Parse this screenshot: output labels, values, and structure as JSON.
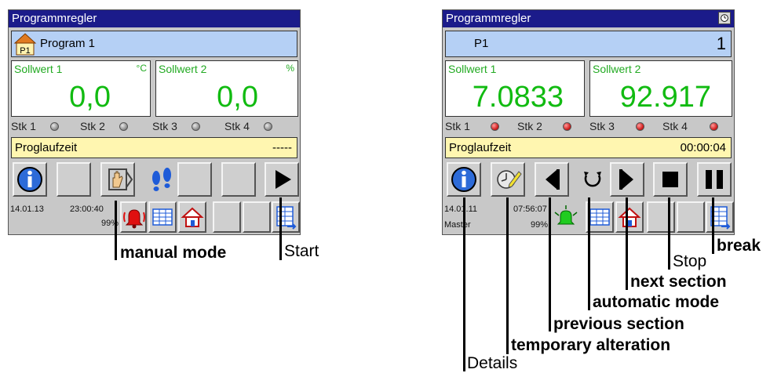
{
  "left_panel": {
    "title": "Programmregler",
    "program_icon_label": "P1",
    "program_name": "Program 1",
    "setpoint1": {
      "label": "Sollwert 1",
      "unit": "°C",
      "value": "0,0"
    },
    "setpoint2": {
      "label": "Sollwert 2",
      "unit": "%",
      "value": "0,0"
    },
    "stk": [
      "Stk 1",
      "Stk 2",
      "Stk 3",
      "Stk 4"
    ],
    "stk_state": "grey",
    "time_label": "Proglaufzeit",
    "time_value": "-----",
    "status_date": "14.01.13",
    "status_time": "23:00:40",
    "status_percent": "99%"
  },
  "right_panel": {
    "title": "Programmregler",
    "program_name": "P1",
    "program_number": "1",
    "setpoint1": {
      "label": "Sollwert 1",
      "value": "7.0833"
    },
    "setpoint2": {
      "label": "Sollwert 2",
      "value": "92.917"
    },
    "stk": [
      "Stk 1",
      "Stk 2",
      "Stk 3",
      "Stk 4"
    ],
    "stk_state": "red",
    "time_label": "Proglaufzeit",
    "time_value": "00:00:04",
    "status_date": "14.01.11",
    "status_time": "07:56:07",
    "status_user": "Master",
    "status_percent": "99%"
  },
  "callouts": {
    "manual_mode": "manual mode",
    "start": "Start",
    "stop": "Stop",
    "break": "break",
    "next_section": "next section",
    "automatic_mode": "automatic mode",
    "previous_section": "previous section",
    "temporary_alteration": "temporary alteration",
    "details": "Details"
  },
  "colors": {
    "titlebar": "#1b1b8a",
    "setpoint_text": "#11bb11",
    "program_bar": "#b5d0f5",
    "time_bar": "#fff6b0"
  }
}
